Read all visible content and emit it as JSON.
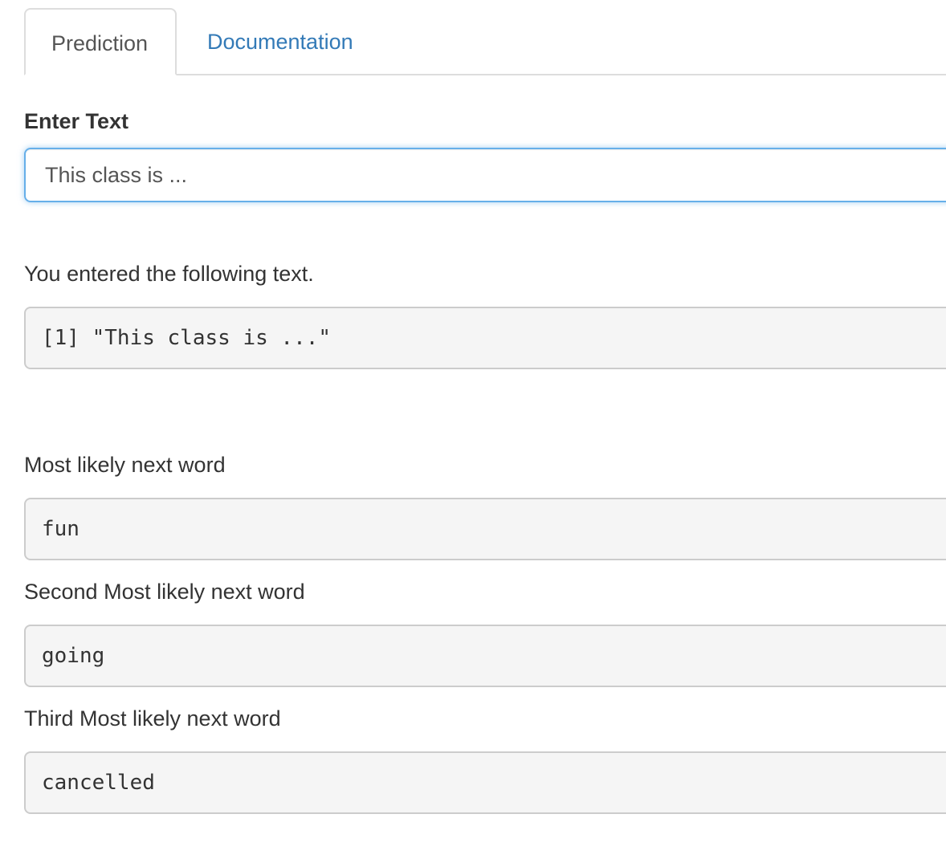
{
  "tabs": [
    {
      "label": "Prediction",
      "active": true
    },
    {
      "label": "Documentation",
      "active": false
    }
  ],
  "input": {
    "label": "Enter Text",
    "value": "This class is ..."
  },
  "echo": {
    "label": "You entered the following text.",
    "output": "[1] \"This class is ...\""
  },
  "predictions": [
    {
      "label": "Most likely next word",
      "word": "fun"
    },
    {
      "label": "Second Most likely next word",
      "word": "going"
    },
    {
      "label": "Third Most likely next word",
      "word": "cancelled"
    }
  ],
  "colors": {
    "link": "#337ab7",
    "focus_border": "#66afe9",
    "output_bg": "#f5f5f5"
  }
}
